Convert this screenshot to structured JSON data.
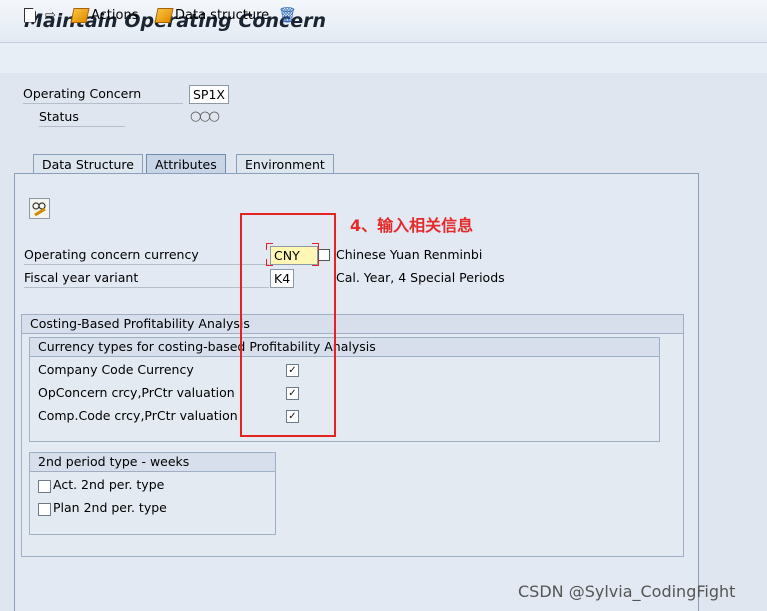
{
  "title": "Maintain Operating Concern",
  "toolbar": {
    "actions_label": "Actions",
    "data_structure_label": "Data structure"
  },
  "header": {
    "operating_concern_label": "Operating Concern",
    "operating_concern_value": "SP1X",
    "status_label": "Status",
    "status_icons": "○○○"
  },
  "tabs": [
    {
      "label": "Data Structure"
    },
    {
      "label": "Attributes"
    },
    {
      "label": "Environment"
    }
  ],
  "annotation": "4、输入相关信息",
  "currency": {
    "label": "Operating concern currency",
    "value": "CNY",
    "description": "Chinese Yuan Renminbi"
  },
  "fiscal": {
    "label": "Fiscal year variant",
    "value": "K4",
    "description": "Cal. Year, 4 Special Periods"
  },
  "costing_group": {
    "title": "Costing-Based Profitability Analysis",
    "currency_types": {
      "title": "Currency types for costing-based Profitability Analysis",
      "items": [
        {
          "label": "Company Code Currency",
          "checked": "✓"
        },
        {
          "label": "OpConcern crcy,PrCtr valuation",
          "checked": "✓"
        },
        {
          "label": "Comp.Code crcy,PrCtr valuation",
          "checked": "✓"
        }
      ]
    },
    "period": {
      "title": "2nd period type - weeks",
      "items": [
        {
          "label": "Act. 2nd per. type"
        },
        {
          "label": "Plan 2nd per. type"
        }
      ]
    }
  },
  "watermark": "CSDN @Sylvia_CodingFight"
}
